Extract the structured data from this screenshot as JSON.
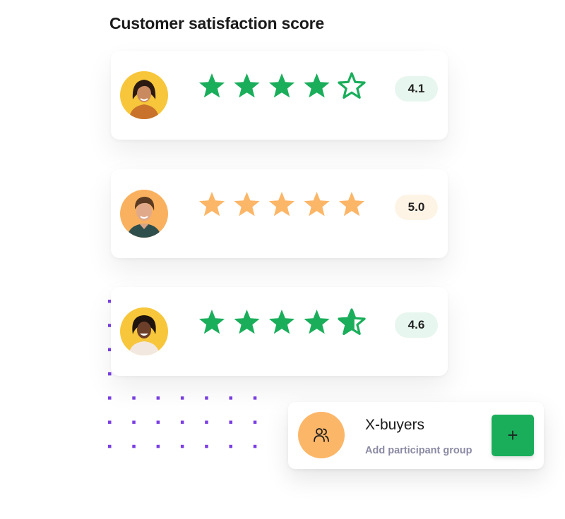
{
  "title": "Customer satisfaction score",
  "colors": {
    "green": "#1aae5b",
    "orange": "#fcb668",
    "green_badge_bg": "#e7f6ee",
    "orange_badge_bg": "#fdf4e6",
    "dots": "#7b3fe4",
    "avatar_bg_yellow": "#f7c63a",
    "avatar_bg_orange": "#f9b15f"
  },
  "ratings": [
    {
      "score": "4.1",
      "value": 4.1,
      "max": 5,
      "star_color": "#1aae5b",
      "badge_bg": "#e7f6ee",
      "avatar_bg": "#f7c63a",
      "avatar_icon": "person-avatar-icon"
    },
    {
      "score": "5.0",
      "value": 5.0,
      "max": 5,
      "star_color": "#fcb668",
      "badge_bg": "#fdf4e6",
      "avatar_bg": "#f9b15f",
      "avatar_icon": "person-avatar-icon"
    },
    {
      "score": "4.6",
      "value": 4.6,
      "max": 5,
      "star_color": "#1aae5b",
      "badge_bg": "#e7f6ee",
      "avatar_bg": "#f7c63a",
      "avatar_icon": "person-avatar-icon"
    }
  ],
  "group": {
    "name": "X-buyers",
    "subtitle": "Add participant group",
    "icon": "users-icon",
    "icon_bg": "#fcb668",
    "add_label": "+",
    "add_bg": "#1aae5b"
  }
}
